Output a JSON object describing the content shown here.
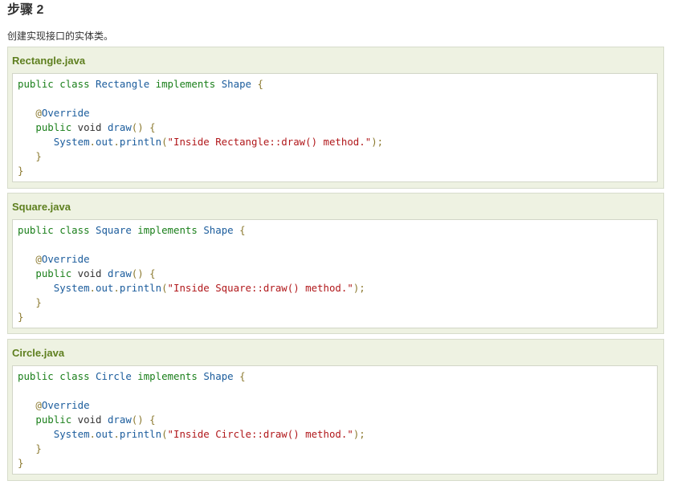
{
  "step": {
    "title": "步骤 2",
    "description": "创建实现接口的实体类。"
  },
  "examples": [
    {
      "filename": "Rectangle.java",
      "class_name": "Rectangle",
      "interface": "Shape",
      "message": "\"Inside Rectangle::draw() method.\""
    },
    {
      "filename": "Square.java",
      "class_name": "Square",
      "interface": "Shape",
      "message": "\"Inside Square::draw() method.\""
    },
    {
      "filename": "Circle.java",
      "class_name": "Circle",
      "interface": "Shape",
      "message": "\"Inside Circle::draw() method.\""
    }
  ],
  "code_tokens": {
    "public": "public",
    "class": "class",
    "implements": "implements",
    "open_brace": "{",
    "close_brace": "}",
    "annotation_at": "@",
    "annotation": "Override",
    "void": "void",
    "method": "draw",
    "parens": "()",
    "system": "System",
    "dot": ".",
    "out": "out",
    "println": "println",
    "open_paren": "(",
    "close_paren_semi": ");"
  },
  "colors": {
    "panel_bg": "#eef2e2",
    "title_green": "#5e7f1f",
    "keyword_green": "#1a7f1a",
    "type_blue": "#1b5c9c",
    "string_red": "#b1181b"
  }
}
